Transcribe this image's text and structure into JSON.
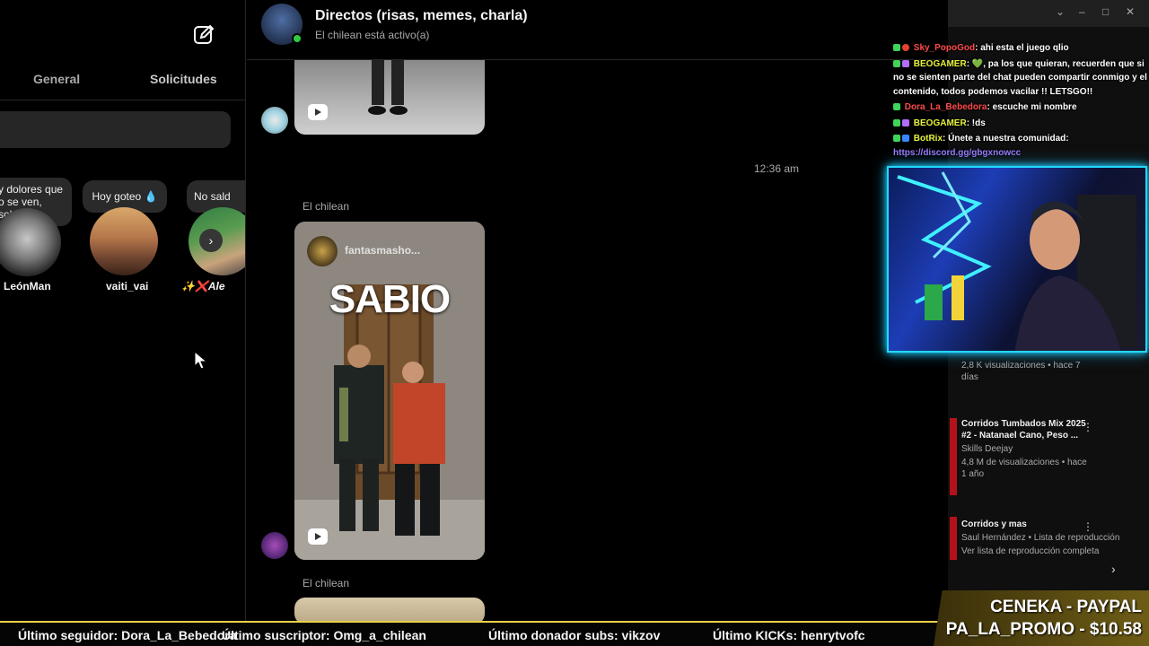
{
  "inbox": {
    "tabs": [
      "General",
      "Solicitudes"
    ],
    "notes": [
      "y dolores que\no se ven, solo\ne sienten 😩",
      "Hoy goteo 💧",
      "No sald"
    ],
    "stories": [
      "LeónMan",
      "vaiti_vai",
      "✨❌Ale"
    ]
  },
  "chat": {
    "title": "Directos (risas, memes, charla)",
    "status": "El chilean está activo(a)",
    "timestamp": "12:36 am",
    "sender": "El chilean",
    "post_user": "fantasmasho...",
    "post_headline": "SABIO"
  },
  "stream_chat": [
    {
      "user": "Sky_PopoGod",
      "text": ": ahi esta el juego qlio"
    },
    {
      "user": "BEOGAMER",
      "text": ": 💚, pa los que quieran, recuerden que si no se sienten parte del chat pueden compartir conmigo y el contenido, todos podemos vacilar !! LETSGO!!"
    },
    {
      "user": "Dora_La_Bebedora",
      "text": ": escuche mi nombre"
    },
    {
      "user": "BEOGAMER",
      "text": ": !ds"
    },
    {
      "user": "BotRix",
      "text": ": Únete a nuestra comunidad:",
      "link": "https://discord.gg/gbgxnowcc"
    }
  ],
  "youtube": {
    "items": [
      {
        "title": "",
        "meta": "2,8 K visualizaciones • hace 7 días"
      },
      {
        "title": "Corridos Tumbados Mix 2025 #2 - Natanael Cano, Peso ...",
        "channel": "Skills Deejay",
        "meta": "4,8 M de visualizaciones • hace 1 año"
      },
      {
        "title": "Corridos y mas",
        "channel": "Saul Hernández • Lista de reproducción",
        "meta": "Ver lista de reproducción completa"
      }
    ]
  },
  "ticker": {
    "follower": "Último seguidor: Dora_La_Bebedora",
    "subscriber": "Último suscriptor: Omg_a_chilean",
    "donor": "Último donador subs: vikzov",
    "kicks": "Último KICKs: henrytvofc"
  },
  "promo": {
    "line1": "CENEKA - PAYPAL",
    "line2": "PA_LA_PROMO - $10.58"
  }
}
